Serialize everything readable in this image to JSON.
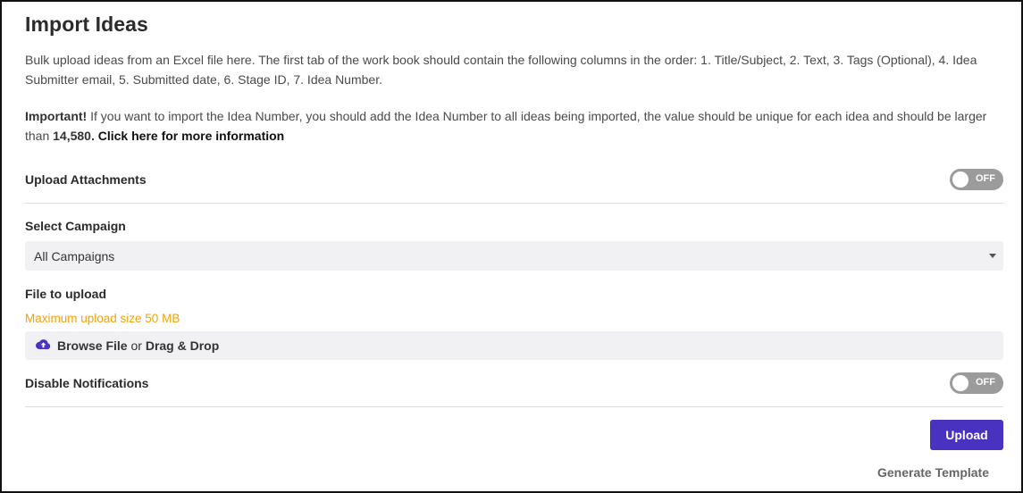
{
  "title": "Import Ideas",
  "description": "Bulk upload ideas from an Excel file here. The first tab of the work book should contain the following columns in the order: 1. Title/Subject, 2. Text, 3. Tags (Optional), 4. Idea Submitter email, 5. Submitted date, 6. Stage ID, 7. Idea Number.",
  "important": {
    "prefix": "Important!",
    "text": " If you want to import the Idea Number, you should add the Idea Number to all ideas being imported, the value should be unique for each idea and should be larger than ",
    "number": "14,580.",
    "link": " Click here for more information"
  },
  "upload_attachments": {
    "label": "Upload Attachments",
    "toggle": "OFF"
  },
  "campaign": {
    "label": "Select Campaign",
    "selected": "All Campaigns"
  },
  "file": {
    "label": "File to upload",
    "max_size": "Maximum upload size 50 MB",
    "browse": "Browse File",
    "or": " or ",
    "drag_drop": "Drag & Drop"
  },
  "disable_notifications": {
    "label": "Disable Notifications",
    "toggle": "OFF"
  },
  "upload_button": "Upload",
  "generate_template": "Generate Template",
  "colors": {
    "accent": "#4932bf",
    "warning": "#f0a30a",
    "toggle_off": "#9b9b9b"
  }
}
